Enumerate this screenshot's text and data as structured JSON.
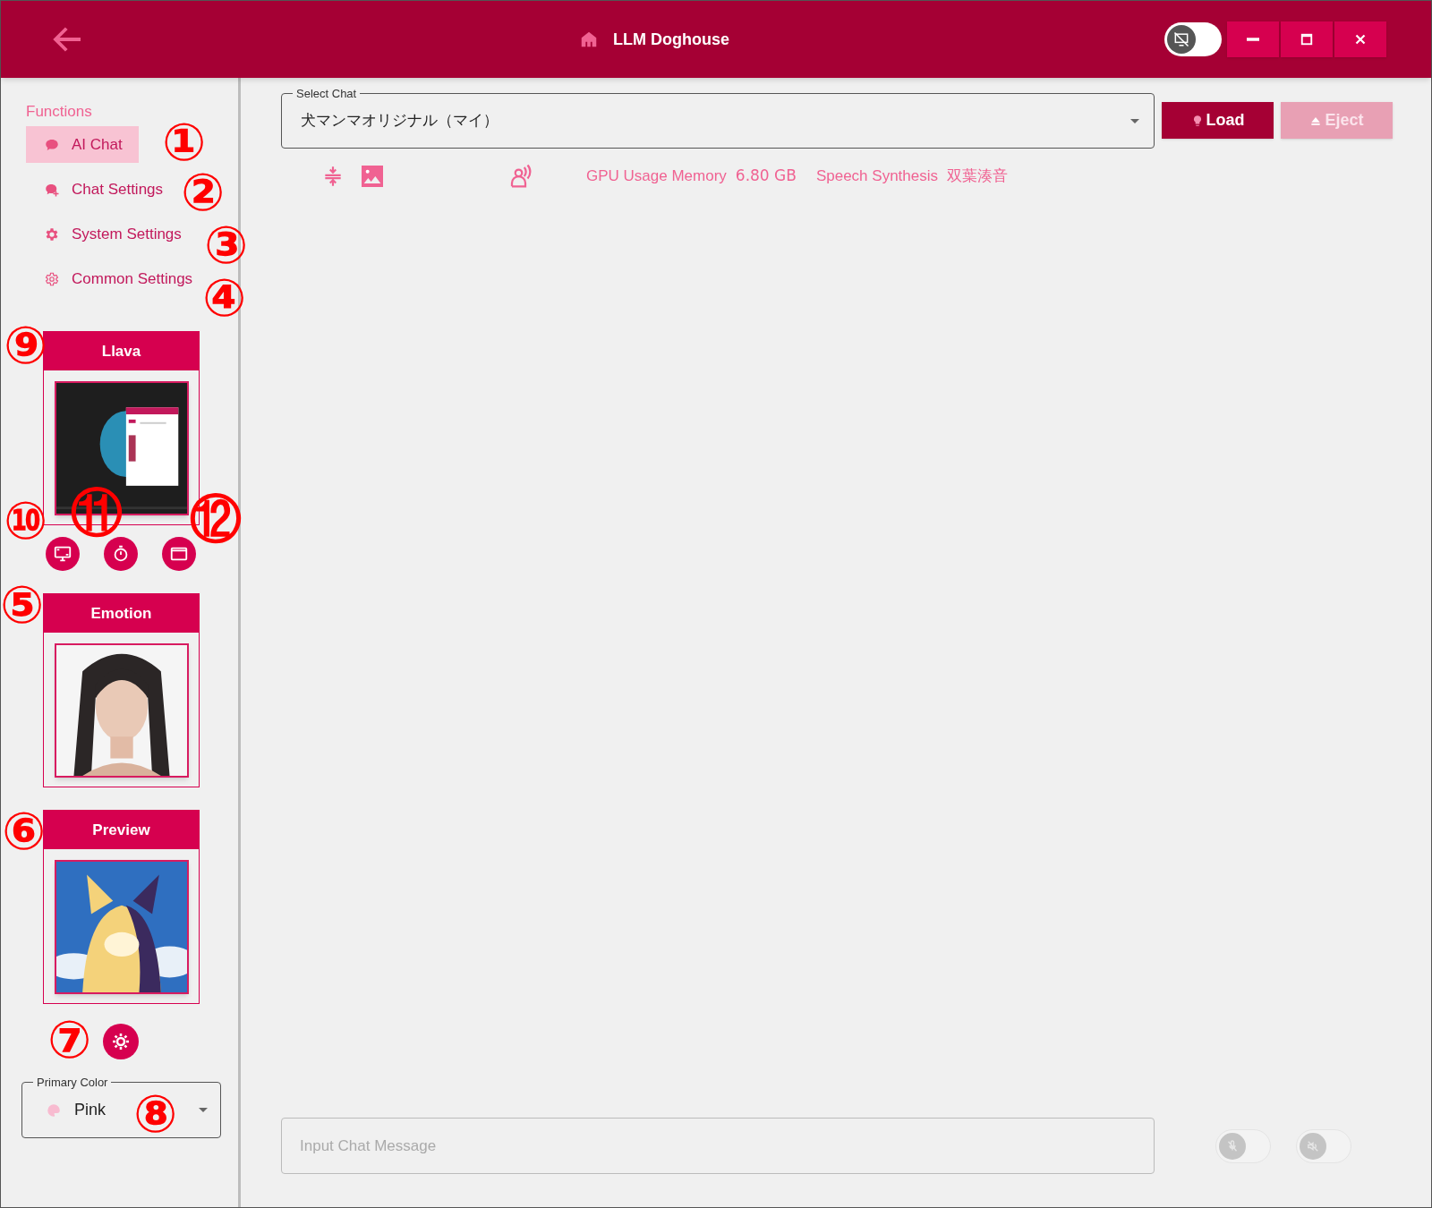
{
  "window": {
    "title": "LLM Doghouse",
    "theme_toggle": {
      "on": false
    }
  },
  "sidebar": {
    "heading": "Functions",
    "items": [
      {
        "label": "AI Chat",
        "kind": "chat",
        "selected": true
      },
      {
        "label": "Chat Settings",
        "kind": "chat-add",
        "selected": false
      },
      {
        "label": "System Settings",
        "kind": "gear-solid",
        "selected": false
      },
      {
        "label": "Common Settings",
        "kind": "gear-outline",
        "selected": false
      }
    ],
    "panels": [
      {
        "title": "Llava",
        "kind": "picture"
      },
      {
        "title": "Emotion",
        "kind": "picture"
      },
      {
        "title": "Preview",
        "kind": "picture"
      }
    ],
    "primary_color": {
      "label": "Primary Color",
      "value": "Pink"
    }
  },
  "main": {
    "select_chat": {
      "label": "Select Chat",
      "value": "犬マンマオリジナル（マイ）"
    },
    "buttons": [
      {
        "label": "Load",
        "disabled": false
      },
      {
        "label": "Eject",
        "disabled": true
      }
    ],
    "status": [
      {
        "label": "GPU Usage Memory",
        "value": "6.80 GB"
      },
      {
        "label": "Speech Synthesis",
        "value": "双葉湊音"
      }
    ],
    "input": {
      "placeholder": "Input Chat Message"
    },
    "toggles": [
      {
        "kind": "mic",
        "on": false
      },
      {
        "kind": "speaker",
        "on": false
      }
    ]
  },
  "annotations": [
    {
      "label": "①"
    },
    {
      "label": "②"
    },
    {
      "label": "③"
    },
    {
      "label": "④"
    },
    {
      "label": "⑨"
    },
    {
      "label": "⑩"
    },
    {
      "label": "⑪"
    },
    {
      "label": "⑫"
    },
    {
      "label": "⑤"
    },
    {
      "label": "⑥"
    },
    {
      "label": "⑦"
    },
    {
      "label": "⑧"
    }
  ]
}
